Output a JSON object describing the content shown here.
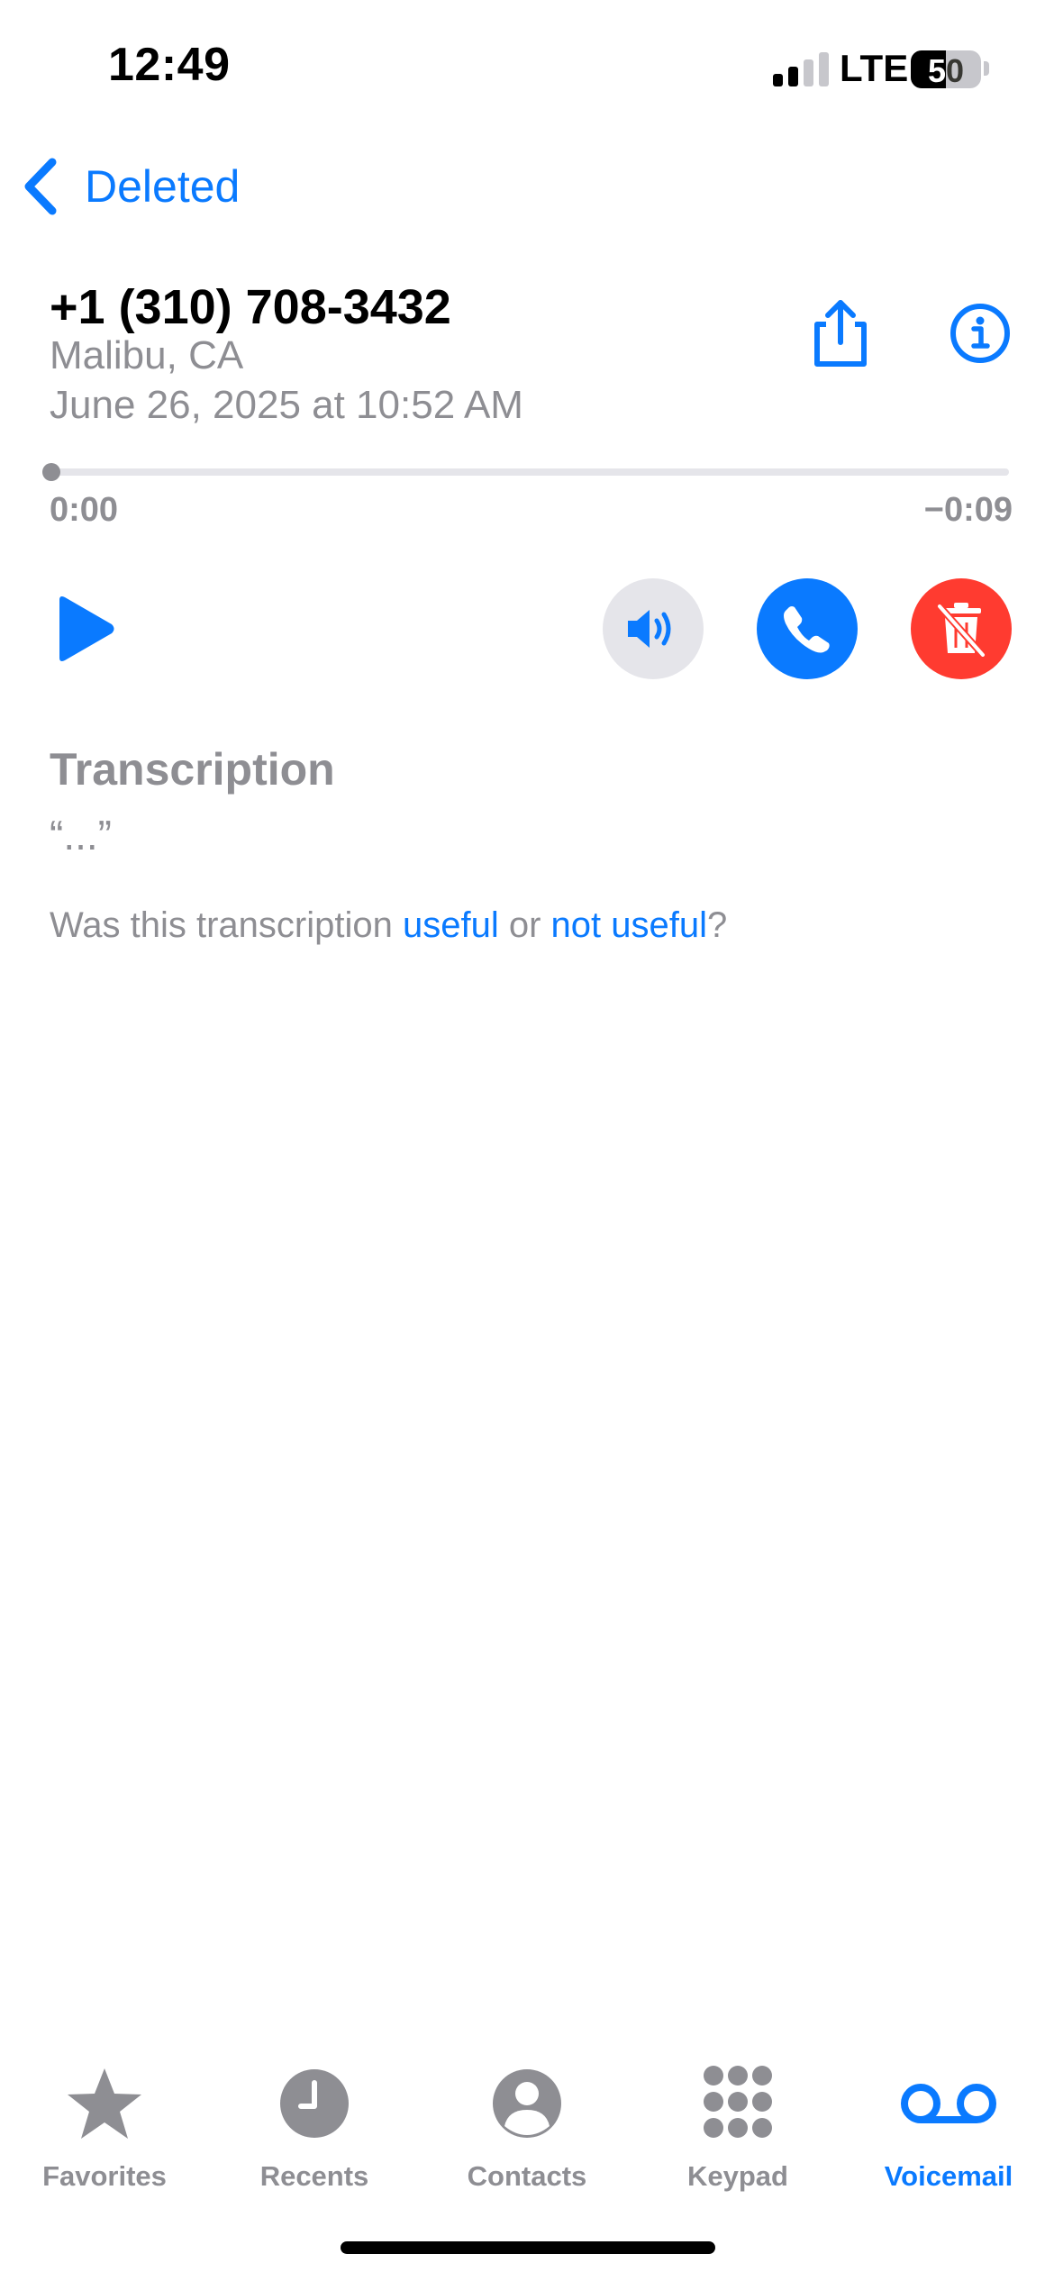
{
  "status_bar": {
    "time": "12:49",
    "network": "LTE",
    "battery": "50",
    "battery_level": 0.5
  },
  "nav": {
    "back_label": "Deleted"
  },
  "voicemail": {
    "number": "+1 (310) 708-3432",
    "location": "Malibu, CA",
    "datetime": "June 26, 2025 at 10:52 AM",
    "elapsed": "0:00",
    "remaining": "−0:09",
    "progress": 0
  },
  "transcription": {
    "title": "Transcription",
    "text": "“...”",
    "feedback_prefix": "Was this transcription ",
    "useful": "useful",
    "or": " or ",
    "not_useful": "not useful",
    "suffix": "?"
  },
  "tabs": [
    {
      "label": "Favorites",
      "icon": "star-icon"
    },
    {
      "label": "Recents",
      "icon": "clock-icon"
    },
    {
      "label": "Contacts",
      "icon": "person-icon"
    },
    {
      "label": "Keypad",
      "icon": "keypad-icon"
    },
    {
      "label": "Voicemail",
      "icon": "voicemail-icon",
      "active": true
    }
  ],
  "colors": {
    "accent": "#0a7aff",
    "destructive": "#ff3b30",
    "secondary_text": "#8e8e93"
  }
}
